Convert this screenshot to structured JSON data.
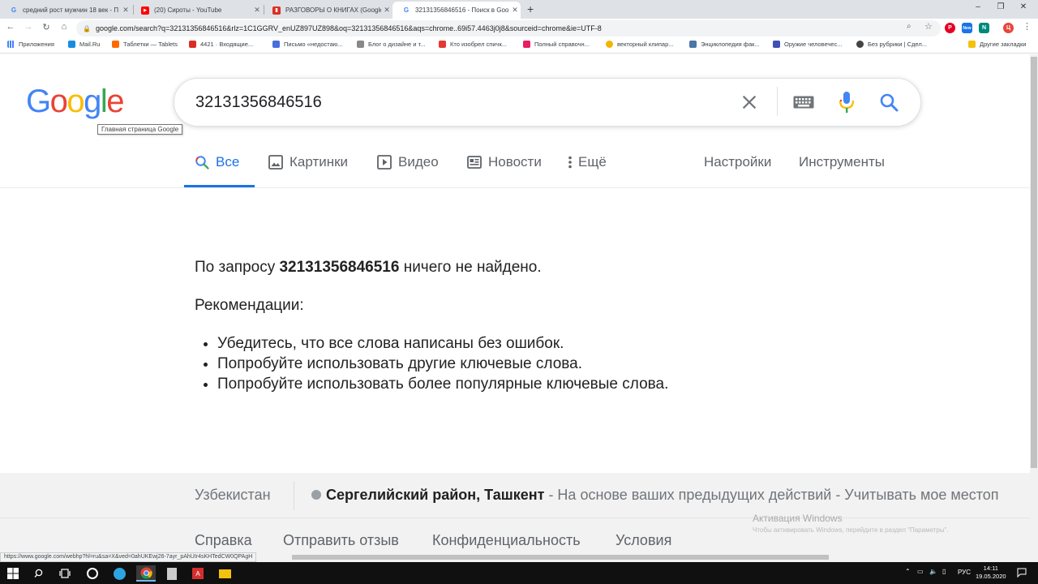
{
  "browser": {
    "tabs": [
      {
        "title": "средний рост мужчин 18 век - П",
        "favicon": "G",
        "active": false
      },
      {
        "title": "(20) Сироты - YouTube",
        "favicon": "yt",
        "active": false
      },
      {
        "title": "РАЗГОВОРЫ О КНИГАХ (Google",
        "favicon": "bk",
        "active": false
      },
      {
        "title": "32131356846516 - Поиск в Goo",
        "favicon": "G",
        "active": true
      }
    ],
    "new_tab": "+",
    "window_controls": {
      "minimize": "–",
      "maximize": "❐",
      "close": "✕"
    },
    "url": "google.com/search?q=32131356846516&rlz=1C1GGRV_enUZ897UZ898&oq=32131356846516&aqs=chrome..69i57.4463j0j8&sourceid=chrome&ie=UTF-8",
    "ext_badge": "New",
    "profile": "Ц",
    "bookmarks": [
      {
        "label": "Приложения",
        "color": "#5f6368"
      },
      {
        "label": "Mail.Ru",
        "color": "#168de2"
      },
      {
        "label": "Таблетки — Tablets",
        "color": "#ff6a00"
      },
      {
        "label": "4421 · Входящие...",
        "color": "#d93025"
      },
      {
        "label": "Письмо «недостаю...",
        "color": "#4a6ee0"
      },
      {
        "label": "Блог о дизайне и т...",
        "color": "#888"
      },
      {
        "label": "Кто изобрел спичк...",
        "color": "#e53935"
      },
      {
        "label": "Полный справочн...",
        "color": "#e91e63"
      },
      {
        "label": "векторный клипар...",
        "color": "#f4b400"
      },
      {
        "label": "Энциклопедия фак...",
        "color": "#4a76a8"
      },
      {
        "label": "Оружие человечес...",
        "color": "#3f51b5"
      },
      {
        "label": "Без рубрики | Сдел...",
        "color": "#444"
      },
      {
        "label": "Другие закладки",
        "color": "#f4c20d"
      }
    ]
  },
  "logo": {
    "letters": [
      "G",
      "o",
      "o",
      "g",
      "l",
      "e"
    ]
  },
  "logo_tooltip": "Главная страница Google",
  "search": {
    "query": "32131356846516"
  },
  "nav_tabs": {
    "all": "Все",
    "images": "Картинки",
    "video": "Видео",
    "news": "Новости",
    "more": "Ещё",
    "settings": "Настройки",
    "tools": "Инструменты"
  },
  "results": {
    "no_result_prefix": "По запросу ",
    "no_result_query": "32131356846516",
    "no_result_suffix": " ничего не найдено.",
    "recommendations_title": "Рекомендации:",
    "recommendations": [
      "Убедитесь, что все слова написаны без ошибок.",
      "Попробуйте использовать другие ключевые слова.",
      "Попробуйте использовать более популярные ключевые слова."
    ]
  },
  "footer": {
    "country": "Узбекистан",
    "location": "Сергелийский район, Ташкент",
    "location_note": " - На основе ваших предыдущих действий - Учитывать мое местоп",
    "links": [
      "Справка",
      "Отправить отзыв",
      "Конфиденциальность",
      "Условия"
    ]
  },
  "windows_activation": {
    "title": "Активация Windows",
    "subtitle": "Чтобы активировать Windows, перейдите в раздел \"Параметры\"."
  },
  "status_url": "https://www.google.com/webhp?hl=ru&sa=X&ved=0ahUKEwj26-7ayr_pAhUIr4sKHTedCW0QPAgH",
  "taskbar": {
    "lang": "РУС",
    "time": "14:11",
    "date": "19.05.2020"
  },
  "colors": {
    "google_blue": "#4285F4",
    "google_red": "#EA4335",
    "google_yellow": "#FBBC05",
    "google_green": "#34A853",
    "active_tab": "#1a73e8"
  }
}
